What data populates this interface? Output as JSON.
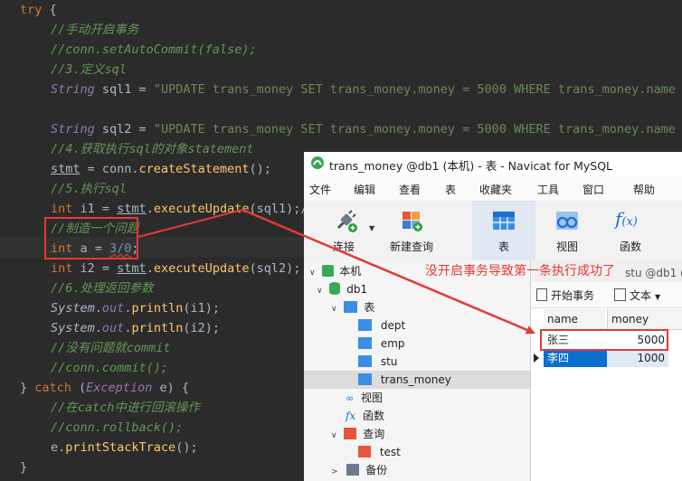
{
  "code": {
    "try_kw": "try",
    "brace_open": " {",
    "c1": "//手动开启事务",
    "c2": "//conn.setAutoCommit(false);",
    "c3": "//3.定义sql",
    "sql1_type": "String",
    "sql1_rest": " sql1 = ",
    "sql1_str": "\"UPDATE trans_money SET trans_money.money = 5000 WHERE trans_money.name = ",
    "sql2_type": "String",
    "sql2_rest": " sql2 = ",
    "sql2_str": "\"UPDATE trans_money SET trans_money.money = 5000 WHERE trans_money.name = ",
    "c4": "//4.获取执行sql的对象statement",
    "stmt": "stmt",
    "stmt_assign": " = conn.",
    "create_fn": "createStatement",
    "create_tail": "();",
    "c5": "//5.执行sql",
    "i1_kw": "int",
    "i1_mid": " i1 = ",
    "i1_stmt": "stmt",
    "i1_dot": ".",
    "exec_fn1": "executeUpdate",
    "i1_tail": "(sql1);/",
    "c_err": "//制造一个问题",
    "a_kw": "int",
    "a_mid": " a = ",
    "a_val": "3/0",
    "a_tail": ";",
    "i2_kw": "int",
    "i2_mid": " i2 = ",
    "i2_stmt": "stmt",
    "i2_dot": ".",
    "exec_fn2": "executeUpdate",
    "i2_tail": "(sql2);",
    "c6": "//6.处理返回参数",
    "sys1": "System",
    "dot1": ".",
    "out1": "out",
    "pr1_dot": ".",
    "println1": "println",
    "pr1_tail": "(i1);",
    "sys2": "System",
    "dot2": ".",
    "out2": "out",
    "pr2_dot": ".",
    "println2": "println",
    "pr2_tail": "(i2);",
    "c7": "//没有问题就commit",
    "c8": "//conn.commit();",
    "catch_close": "} ",
    "catch_kw": "catch",
    "catch_paren": " (",
    "exc_type": "Exception",
    "catch_var": " e) {",
    "c9": "//在catch中进行回滚操作",
    "c10": "//conn.rollback();",
    "e_var": "e.",
    "pst_fn": "printStackTrace",
    "pst_tail": "();",
    "close_brace": "}"
  },
  "navicat": {
    "title": "trans_money @db1 (本机) - 表 - Navicat for MySQL",
    "menu": [
      "文件",
      "编辑",
      "查看",
      "表",
      "收藏夹",
      "工具",
      "窗口",
      "帮助"
    ],
    "toolbar": {
      "connect": "连接",
      "new_query": "新建查询",
      "table": "表",
      "view": "视图",
      "function": "函数"
    },
    "tree": {
      "root": "本机",
      "db": "db1",
      "tables": "表",
      "table_items": [
        "dept",
        "emp",
        "stu",
        "trans_money"
      ],
      "views": "视图",
      "functions": "函数",
      "queries": "查询",
      "query_items": [
        "test"
      ],
      "backup": "备份"
    },
    "tab_partial": "stu @db1 (本",
    "actions": {
      "begin_tx": "开始事务",
      "text": "文本"
    },
    "grid": {
      "columns": [
        "name",
        "money"
      ],
      "rows": [
        {
          "name": "张三",
          "money": "5000"
        },
        {
          "name": "李四",
          "money": "1000"
        }
      ]
    }
  },
  "annotation": "没开启事务导致第一条执行成功了",
  "colors": {
    "annotation": "#e53935",
    "keyword": "#cc7832",
    "comment": "#629755",
    "string": "#6a8759",
    "selection": "#0a70d0"
  }
}
